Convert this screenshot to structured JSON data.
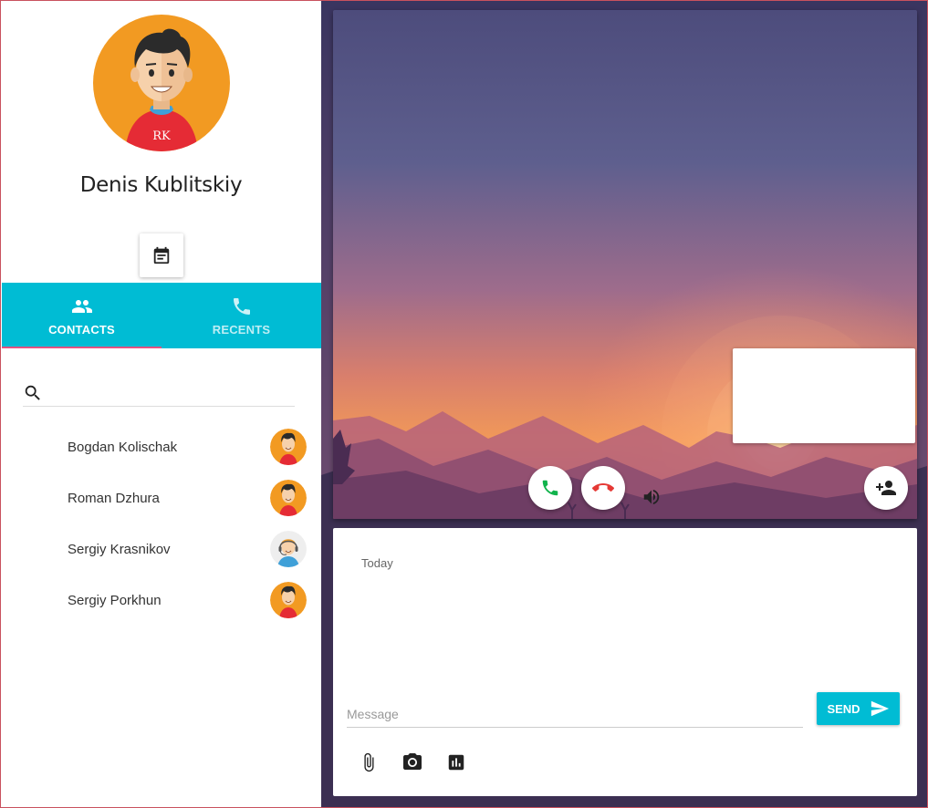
{
  "profile": {
    "name": "Denis Kublitskiy",
    "shirt_initials": "RK"
  },
  "tabs": [
    {
      "label": "CONTACTS",
      "icon": "people-icon",
      "active": true
    },
    {
      "label": "RECENTS",
      "icon": "phone-icon",
      "active": false
    }
  ],
  "search": {
    "placeholder": "",
    "value": ""
  },
  "contacts": [
    {
      "name": "Bogdan Kolischak",
      "avatar": "boy-orange"
    },
    {
      "name": "Roman Dzhura",
      "avatar": "boy-orange"
    },
    {
      "name": "Sergiy Krasnikov",
      "avatar": "headset-support"
    },
    {
      "name": "Sergiy Porkhun",
      "avatar": "boy-orange"
    }
  ],
  "call": {
    "accept_icon": "phone-accept-icon",
    "hangup_icon": "phone-hangup-icon",
    "volume_icon": "volume-icon",
    "add_participant_icon": "add-person-icon"
  },
  "chat": {
    "date_divider": "Today",
    "message_placeholder": "Message",
    "send_label": "SEND",
    "tools": [
      "attach-icon",
      "camera-icon",
      "chart-icon"
    ]
  },
  "colors": {
    "accent": "#00bcd4",
    "tab_indicator": "#e45281",
    "accept": "#11b34c",
    "hangup": "#e53935",
    "avatar_bg": "#f29a22",
    "right_bg": "#2e2a4e"
  }
}
